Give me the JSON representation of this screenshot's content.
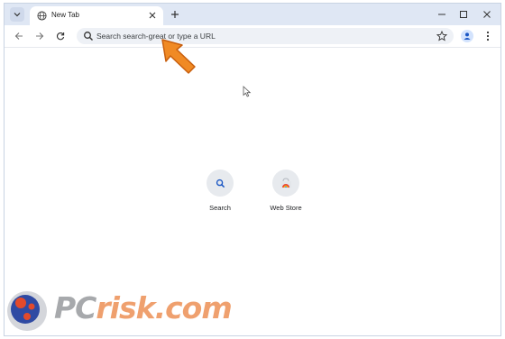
{
  "browser": {
    "tab": {
      "title": "New Tab"
    },
    "omnibox": {
      "placeholder": "Search search-great or type a URL"
    }
  },
  "shortcuts": [
    {
      "label": "Search",
      "icon": "search-icon"
    },
    {
      "label": "Web Store",
      "icon": "web-store-icon"
    }
  ],
  "watermark": {
    "text_pc": "PC",
    "text_risk": "risk.com"
  },
  "colors": {
    "accent": "#e8742a",
    "tabbar": "#dfe7f4",
    "omnibox": "#eef1f6"
  }
}
